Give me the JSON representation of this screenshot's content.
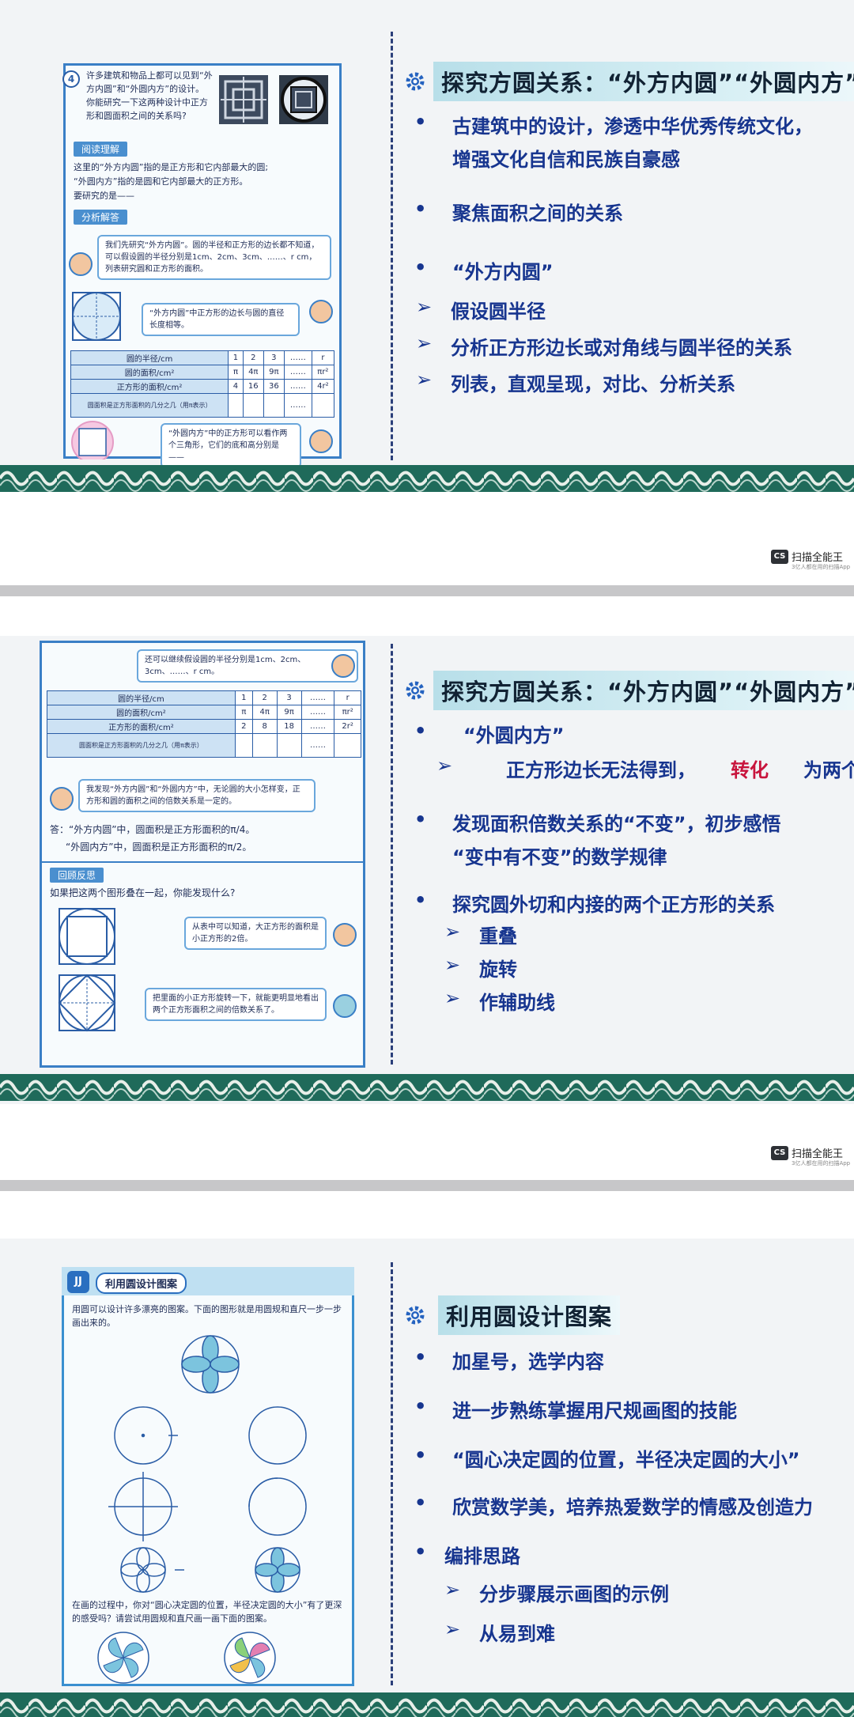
{
  "stamp": {
    "badge": "CS",
    "brand": "扫描全能王",
    "tagline": "3亿人都在用的扫描App"
  },
  "slide1": {
    "heading": "探究方圆关系：“外方内圆”“外圆内方”",
    "bullets": [
      {
        "type": "dot",
        "text": "古建筑中的设计，渗透中华优秀传统文化，"
      },
      {
        "type": "cont",
        "text": "增强文化自信和民族自豪感"
      },
      {
        "type": "dot",
        "text": "聚焦面积之间的关系"
      },
      {
        "type": "dot",
        "text": "“外方内圆”"
      },
      {
        "type": "arrow",
        "text": "假设圆半径"
      },
      {
        "type": "arrow",
        "text": "分析正方形边长或对角线与圆半径的关系"
      },
      {
        "type": "arrow",
        "text": "列表，直观呈现，对比、分析关系"
      }
    ],
    "book": {
      "num": "4",
      "intro": "许多建筑和物品上都可以见到“外方内圆”和“外圆内方”的设计。你能研究一下这两种设计中正方形和圆面积之间的关系吗?",
      "label1": "阅读理解",
      "text1a": "这里的“外方内圆”指的是正方形和它内部最大的圆;",
      "text1b": "“外圆内方”指的是圆和它内部最大的正方形。",
      "text1c": "要研究的是——",
      "label2": "分析解答",
      "bubble1": "我们先研究“外方内圆”。圆的半径和正方形的边长都不知道，可以假设圆的半径分别是1cm、2cm、3cm、……、r cm，列表研究圆和正方形的面积。",
      "bubble2": "“外方内圆”中正方形的边长与圆的直径长度相等。",
      "table": [
        [
          "圆的半径/cm",
          "1",
          "2",
          "3",
          "……",
          "r"
        ],
        [
          "圆的面积/cm²",
          "π",
          "4π",
          "9π",
          "……",
          "πr²"
        ],
        [
          "正方形的面积/cm²",
          "4",
          "16",
          "36",
          "……",
          "4r²"
        ],
        [
          "圆面积是正方形面积的几分之几（用π表示）",
          "",
          "",
          "",
          "……",
          ""
        ]
      ],
      "bubble3": "“外圆内方”中的正方形可以看作两个三角形，它们的底和高分别是——"
    }
  },
  "slide2": {
    "heading": "探究方圆关系：“外方内圆”“外圆内方”",
    "bullets": [
      {
        "type": "dot",
        "text": "“外圆内方”"
      },
      {
        "type": "arrow2",
        "text_a": "正方形边长无法得到，",
        "text_red": "转化",
        "text_b": "为两个三角形"
      },
      {
        "type": "dot",
        "text": "发现面积倍数关系的“不变”，初步感悟"
      },
      {
        "type": "cont",
        "text": "“变中有不变”的数学规律"
      },
      {
        "type": "dot",
        "text": "探究圆外切和内接的两个正方形的关系"
      },
      {
        "type": "arrow",
        "text": "重叠"
      },
      {
        "type": "arrow",
        "text": "旋转"
      },
      {
        "type": "arrow",
        "text": "作辅助线"
      }
    ],
    "book": {
      "bubble1": "还可以继续假设圆的半径分别是1cm、2cm、3cm、……、r cm。",
      "table": [
        [
          "圆的半径/cm",
          "1",
          "2",
          "3",
          "……",
          "r"
        ],
        [
          "圆的面积/cm²",
          "π",
          "4π",
          "9π",
          "……",
          "πr²"
        ],
        [
          "正方形的面积/cm²",
          "2",
          "8",
          "18",
          "……",
          "2r²"
        ],
        [
          "圆面积是正方形面积的几分之几（用π表示）",
          "",
          "",
          "",
          "……",
          ""
        ]
      ],
      "bubble2": "我发现“外方内圆”和“外圆内方”中，无论圆的大小怎样变，正方形和圆的面积之间的倍数关系是一定的。",
      "answer1": "答：“外方内圆”中，圆面积是正方形面积的π/4。",
      "answer2": "“外圆内方”中，圆面积是正方形面积的π/2。",
      "label": "回顾反思",
      "question": "如果把这两个图形叠在一起，你能发现什么?",
      "bubble3": "从表中可以知道，大正方形的面积是小正方形的2倍。",
      "bubble4": "把里面的小正方形旋转一下，就能更明显地看出两个正方形面积之间的倍数关系了。"
    }
  },
  "slide3": {
    "heading": "利用圆设计图案",
    "bullets": [
      {
        "type": "dot",
        "text": "加星号，选学内容"
      },
      {
        "type": "dot",
        "text": "进一步熟练掌握用尺规画图的技能"
      },
      {
        "type": "dot",
        "text": "“圆心决定圆的位置，半径决定圆的大小”"
      },
      {
        "type": "dot",
        "text": "欣赏数学美，培养热爱数学的情感及创造力"
      },
      {
        "type": "dot",
        "text": "编排思路"
      },
      {
        "type": "arrow",
        "text": "分步骤展示画图的示例"
      },
      {
        "type": "arrow",
        "text": "从易到难"
      }
    ],
    "book": {
      "icon": "JJ",
      "title": "利用圆设计图案",
      "intro": "用圆可以设计许多漂亮的图案。下面的图形就是用圆规和直尺一步一步画出来的。",
      "outro": "在画的过程中，你对“圆心决定圆的位置，半径决定圆的大小”有了更深的感受吗？请尝试用圆规和直尺画一画下面的图案。"
    }
  }
}
